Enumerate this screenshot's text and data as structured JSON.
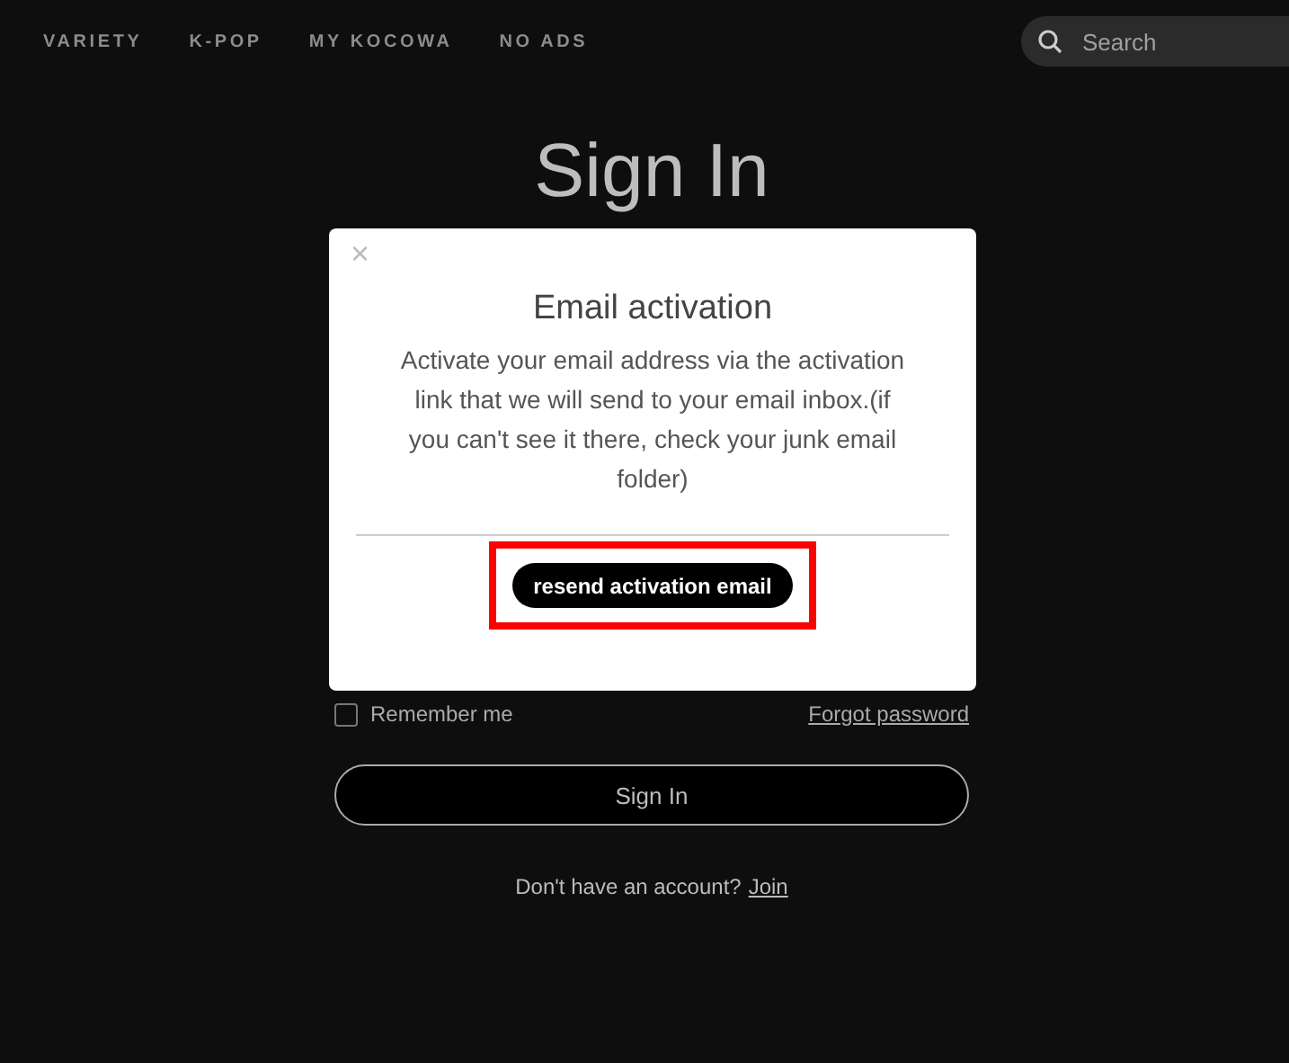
{
  "nav": {
    "items": [
      {
        "label": "VARIETY"
      },
      {
        "label": "K-POP"
      },
      {
        "label": "MY KOCOWA"
      },
      {
        "label": "NO ADS"
      }
    ]
  },
  "search": {
    "placeholder": "Search"
  },
  "page": {
    "title": "Sign In",
    "remember": {
      "label": "Remember me",
      "checked": false
    },
    "forgot": "Forgot password",
    "submit": "Sign In",
    "join_prompt": "Don't have an account?",
    "join_link": "Join"
  },
  "modal": {
    "close": "×",
    "title": "Email activation",
    "message": "Activate your email address via the activation link that we will send to your email inbox.(if you can't see it there, check your junk email folder)",
    "button": {
      "label": "resend activation email",
      "highlighted": true
    }
  }
}
